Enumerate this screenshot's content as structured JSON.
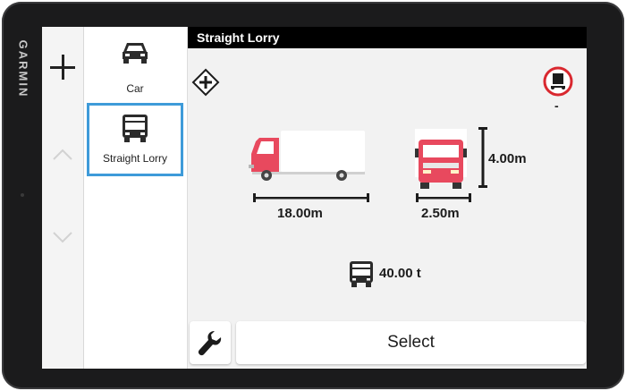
{
  "device": {
    "brand": "GARMIN"
  },
  "side_controls": {
    "add_icon": "plus-icon",
    "up_icon": "chevron-up-icon",
    "down_icon": "chevron-down-icon"
  },
  "vehicle_list": [
    {
      "label": "Car",
      "icon": "car-icon",
      "selected": false
    },
    {
      "label": "Straight Lorry",
      "icon": "lorry-icon",
      "selected": true
    }
  ],
  "header": {
    "title": "Straight Lorry"
  },
  "profile": {
    "length": "18.00m",
    "width": "2.50m",
    "height": "4.00m",
    "weight": "40.00 t",
    "restriction_value": "-"
  },
  "actions": {
    "settings_icon": "wrench-icon",
    "select_label": "Select"
  },
  "colors": {
    "selection_border": "#3e9bd9",
    "truck_cab": "#e8495e",
    "restriction_ring": "#d9282f",
    "header_bg": "#000000"
  }
}
